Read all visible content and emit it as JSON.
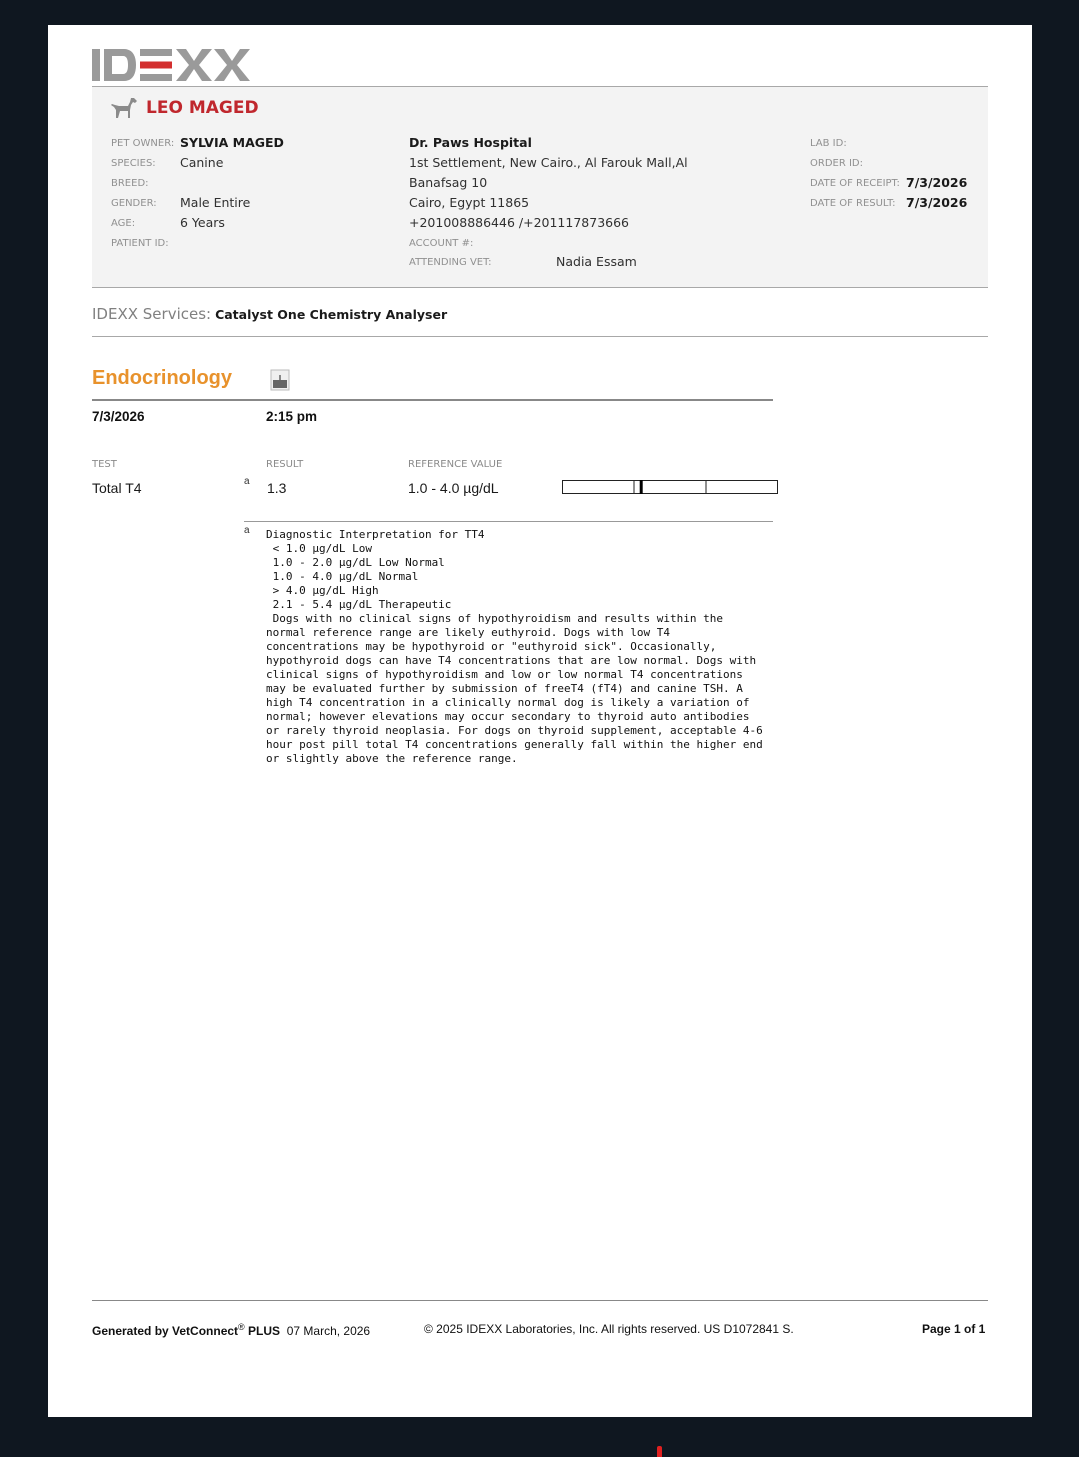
{
  "logo": {
    "text": "IDEXX"
  },
  "patient": {
    "name": "LEO MAGED",
    "icon": "dog-icon",
    "pet_owner_label": "PET OWNER:",
    "pet_owner": "SYLVIA MAGED",
    "species_label": "SPECIES:",
    "species": "Canine",
    "breed_label": "BREED:",
    "gender_label": "GENDER:",
    "gender": "Male Entire",
    "age_label": "AGE:",
    "age": "6 Years",
    "patient_id_label": "PATIENT ID:"
  },
  "clinic": {
    "name": "Dr. Paws Hospital",
    "address_line1": "1st Settlement, New Cairo., Al Farouk Mall,Al",
    "address_line2": "Banafsag 10",
    "address_line3": "Cairo, Egypt 11865",
    "phone": "+201008886446 /+201117873666",
    "account_label": "ACCOUNT #:",
    "attending_vet_label": "ATTENDING VET:",
    "attending_vet": "Nadia Essam"
  },
  "lab": {
    "lab_id_label": "LAB ID:",
    "order_id_label": "ORDER ID:",
    "date_of_receipt_label": "DATE OF RECEIPT:",
    "date_of_receipt": "7/3/2026",
    "date_of_result_label": "DATE OF RESULT:",
    "date_of_result": "7/3/2026"
  },
  "services": {
    "label": "IDEXX Services:",
    "value": "Catalyst One Chemistry Analyser"
  },
  "section": {
    "title": "Endocrinology",
    "icon": "analyzer-icon",
    "date": "7/3/2026",
    "time": "2:15 pm",
    "col_test": "TEST",
    "col_result": "RESULT",
    "col_reference": "REFERENCE VALUE"
  },
  "results": [
    {
      "test": "Total T4",
      "footnote": "a",
      "result": "1.3",
      "reference": "1.0 - 4.0 µg/dL",
      "ref_low": 1.0,
      "ref_high": 4.0,
      "value": 1.3
    }
  ],
  "footnote_marker": "a",
  "interpretation": "Diagnostic Interpretation for TT4\n < 1.0 µg/dL Low\n 1.0 - 2.0 µg/dL Low Normal\n 1.0 - 4.0 µg/dL Normal\n > 4.0 µg/dL High\n 2.1 - 5.4 µg/dL Therapeutic\n Dogs with no clinical signs of hypothyroidism and results within the\nnormal reference range are likely euthyroid. Dogs with low T4\nconcentrations may be hypothyroid or \"euthyroid sick\". Occasionally,\nhypothyroid dogs can have T4 concentrations that are low normal. Dogs with\nclinical signs of hypothyroidism and low or low normal T4 concentrations\nmay be evaluated further by submission of freeT4 (fT4) and canine TSH. A\nhigh T4 concentration in a clinically normal dog is likely a variation of\nnormal; however elevations may occur secondary to thyroid auto antibodies\nor rarely thyroid neoplasia. For dogs on thyroid supplement, acceptable 4-6\nhour post pill total T4 concentrations generally fall within the higher end\nor slightly above the reference range.",
  "footer": {
    "generated_prefix": "Generated by VetConnect",
    "registered": "®",
    "generated_suffix": "PLUS",
    "generated_date": "07 March, 2026",
    "copyright": "© 2025 IDEXX Laboratories, Inc. All rights reserved. US D1072841 S.",
    "page": "Page 1 of 1"
  },
  "colors": {
    "pet_name": "#c0272d",
    "section_title": "#e8922c",
    "logo_gray": "#9a9a9a",
    "logo_red": "#d32f2f"
  }
}
